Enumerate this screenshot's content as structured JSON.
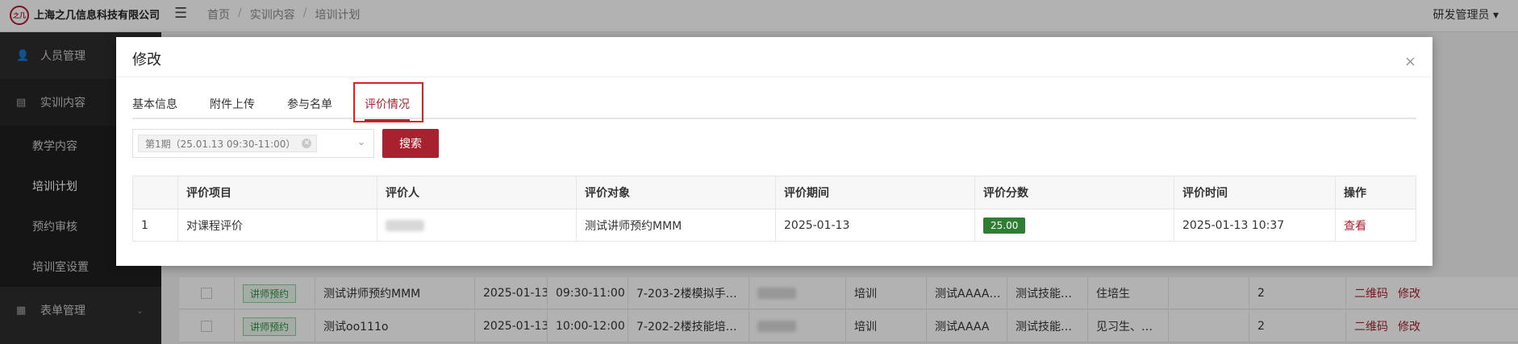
{
  "header": {
    "logo_text": "之几",
    "company": "上海之几信息科技有限公司",
    "breadcrumb": [
      "首页",
      "实训内容",
      "培训计划"
    ],
    "user": "研发管理员"
  },
  "sidebar": {
    "items": [
      {
        "label": "人员管理"
      },
      {
        "label": "实训内容"
      },
      {
        "label": "表单管理"
      }
    ],
    "subitems": [
      {
        "label": "教学内容"
      },
      {
        "label": "培训计划"
      },
      {
        "label": "预约审核"
      },
      {
        "label": "培训室设置"
      }
    ]
  },
  "background_table": {
    "rows": [
      {
        "tag": "讲师预约",
        "name": "测试讲师预约MMM",
        "date": "2025-01-13",
        "time": "09:30-11:00",
        "room": "7-203-2楼模拟手…",
        "type": "培训",
        "col7": "测试AAAA…",
        "col8": "测试技能…",
        "col9": "住培生",
        "count": "2",
        "actions": [
          "二维码",
          "修改"
        ]
      },
      {
        "tag": "讲师预约",
        "name": "测试oo111o",
        "date": "2025-01-13",
        "time": "10:00-12:00",
        "room": "7-202-2楼技能培…",
        "type": "培训",
        "col7": "测试AAAA",
        "col8": "测试技能…",
        "col9": "见习生、…",
        "count": "2",
        "actions": [
          "二维码",
          "修改"
        ]
      }
    ]
  },
  "modal": {
    "title": "修改",
    "close": "×",
    "tabs": [
      {
        "label": "基本信息"
      },
      {
        "label": "附件上传"
      },
      {
        "label": "参与名单"
      },
      {
        "label": "评价情况"
      }
    ],
    "active_tab": "评价情况",
    "filter": {
      "selected_tag": "第1期（25.01.13 09:30-11:00）",
      "search_label": "搜索"
    },
    "table": {
      "columns": [
        "",
        "评价项目",
        "评价人",
        "评价对象",
        "评价期间",
        "评价分数",
        "评价时间",
        "操作"
      ],
      "rows": [
        {
          "index": "1",
          "item": "对课程评价",
          "target": "测试讲师预约MMM",
          "period": "2025-01-13",
          "score": "25.00",
          "time": "2025-01-13 10:37",
          "action": "查看"
        }
      ]
    },
    "colors": {
      "accent": "#a8212f",
      "score_bg": "#2e7d32",
      "highlight": "#e02020"
    }
  }
}
